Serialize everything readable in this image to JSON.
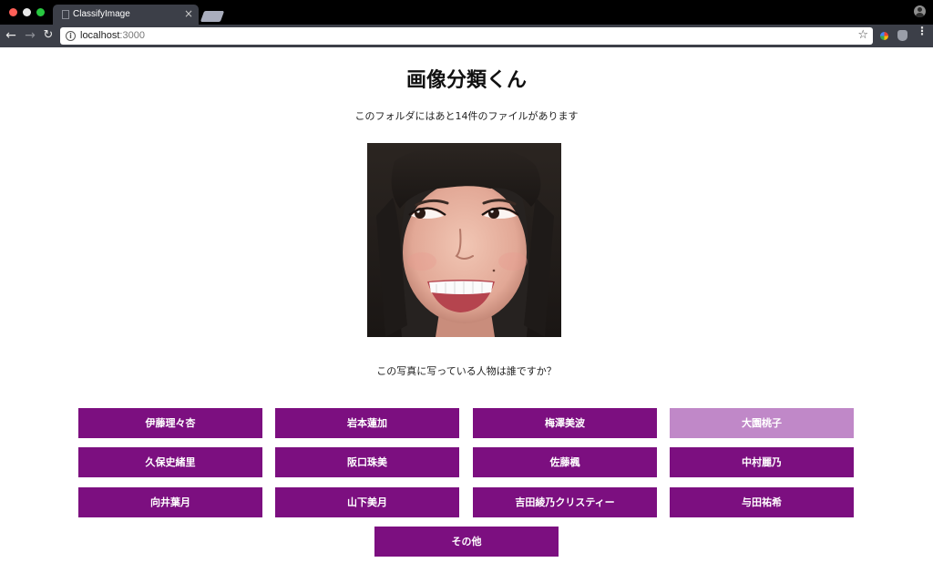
{
  "browser": {
    "tab_title": "ClassifyImage",
    "close_glyph": "×",
    "url_host": "localhost",
    "url_port": ":3000",
    "icons": [
      "back-arrow-icon",
      "forward-arrow-icon",
      "reload-icon",
      "info-icon",
      "star-icon",
      "menu-icon",
      "profile-icon"
    ]
  },
  "page": {
    "title": "画像分類くん",
    "remaining_text": "このフォルダにはあと14件のファイルがあります",
    "question": "この写真に写っている人物は誰ですか？",
    "choices": [
      {
        "label": "伊藤理々杏"
      },
      {
        "label": "岩本蓮加"
      },
      {
        "label": "梅澤美波"
      },
      {
        "label": "大園桃子"
      },
      {
        "label": "久保史緒里"
      },
      {
        "label": "阪口珠美"
      },
      {
        "label": "佐藤楓"
      },
      {
        "label": "中村麗乃"
      },
      {
        "label": "向井葉月"
      },
      {
        "label": "山下美月"
      },
      {
        "label": "吉田綾乃クリスティー"
      },
      {
        "label": "与田祐希"
      }
    ],
    "other_label": "その他"
  },
  "colors": {
    "button": "#7c0f80",
    "button_hover": "#c088c8"
  }
}
